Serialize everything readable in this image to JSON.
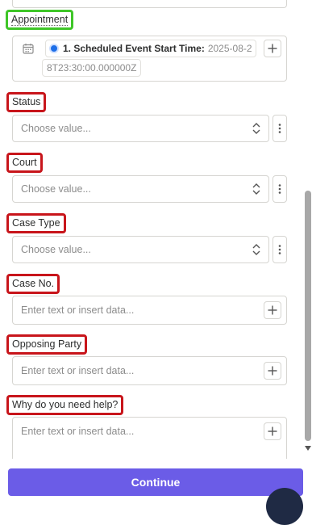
{
  "fields": {
    "appointment": {
      "label": "Appointment",
      "step_label": "1. Scheduled Event Start Time:",
      "value_part1": "2025-08-2",
      "value_part2": "8T23:30:00.000000Z"
    },
    "status": {
      "label": "Status",
      "placeholder": "Choose value..."
    },
    "court": {
      "label": "Court",
      "placeholder": "Choose value..."
    },
    "case_type": {
      "label": "Case Type",
      "placeholder": "Choose value..."
    },
    "case_no": {
      "label": "Case No.",
      "placeholder": "Enter text or insert data..."
    },
    "opposing_party": {
      "label": "Opposing Party",
      "placeholder": "Enter text or insert data..."
    },
    "why_help": {
      "label": "Why do you need help?",
      "placeholder": "Enter text or insert data..."
    }
  },
  "footer": {
    "continue_label": "Continue"
  },
  "colors": {
    "accent": "#6b5ce7",
    "highlight_red": "#c8151b",
    "highlight_green": "#3fc628",
    "step_dot": "#1e6fe8"
  },
  "icons": {
    "calendar": "calendar-icon",
    "chevron": "chevron-updown-icon",
    "kebab": "kebab-menu-icon",
    "plus": "plus-icon"
  }
}
